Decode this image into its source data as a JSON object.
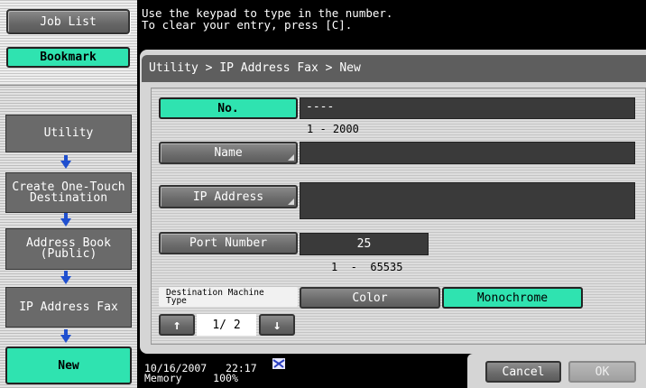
{
  "message": "Use the keypad to type in the number.\nTo clear your entry, press [C].",
  "sidebar": {
    "job_list": "Job List",
    "bookmark": "Bookmark",
    "nav": [
      {
        "label": "Utility"
      },
      {
        "label": "Create One-Touch\nDestination"
      },
      {
        "label": "Address Book\n(Public)"
      },
      {
        "label": "IP Address Fax"
      }
    ],
    "current": "New"
  },
  "header": {
    "breadcrumb": "Utility > IP Address Fax > New"
  },
  "form": {
    "no": {
      "label": "No.",
      "value": "----",
      "range": "1 - 2000"
    },
    "name": {
      "label": "Name",
      "value": ""
    },
    "ip_address": {
      "label": "IP Address",
      "value": ""
    },
    "port": {
      "label": "Port Number",
      "value": "25",
      "range": "1  -  65535"
    },
    "dest_type": {
      "label": "Destination Machine\nType",
      "options": [
        "Color",
        "Monochrome"
      ],
      "selected": "Monochrome"
    }
  },
  "pager": {
    "text": "1/ 2",
    "up": "↑",
    "down": "↓"
  },
  "footer": {
    "date": "10/16/2007",
    "time": "22:17",
    "memory_label": "Memory",
    "memory_value": "100%",
    "cancel": "Cancel",
    "ok": "OK"
  },
  "colors": {
    "accent_green": "#2fe3b0",
    "arrow_blue": "#1f4fcf",
    "dark_button": "#6b6b6b"
  }
}
